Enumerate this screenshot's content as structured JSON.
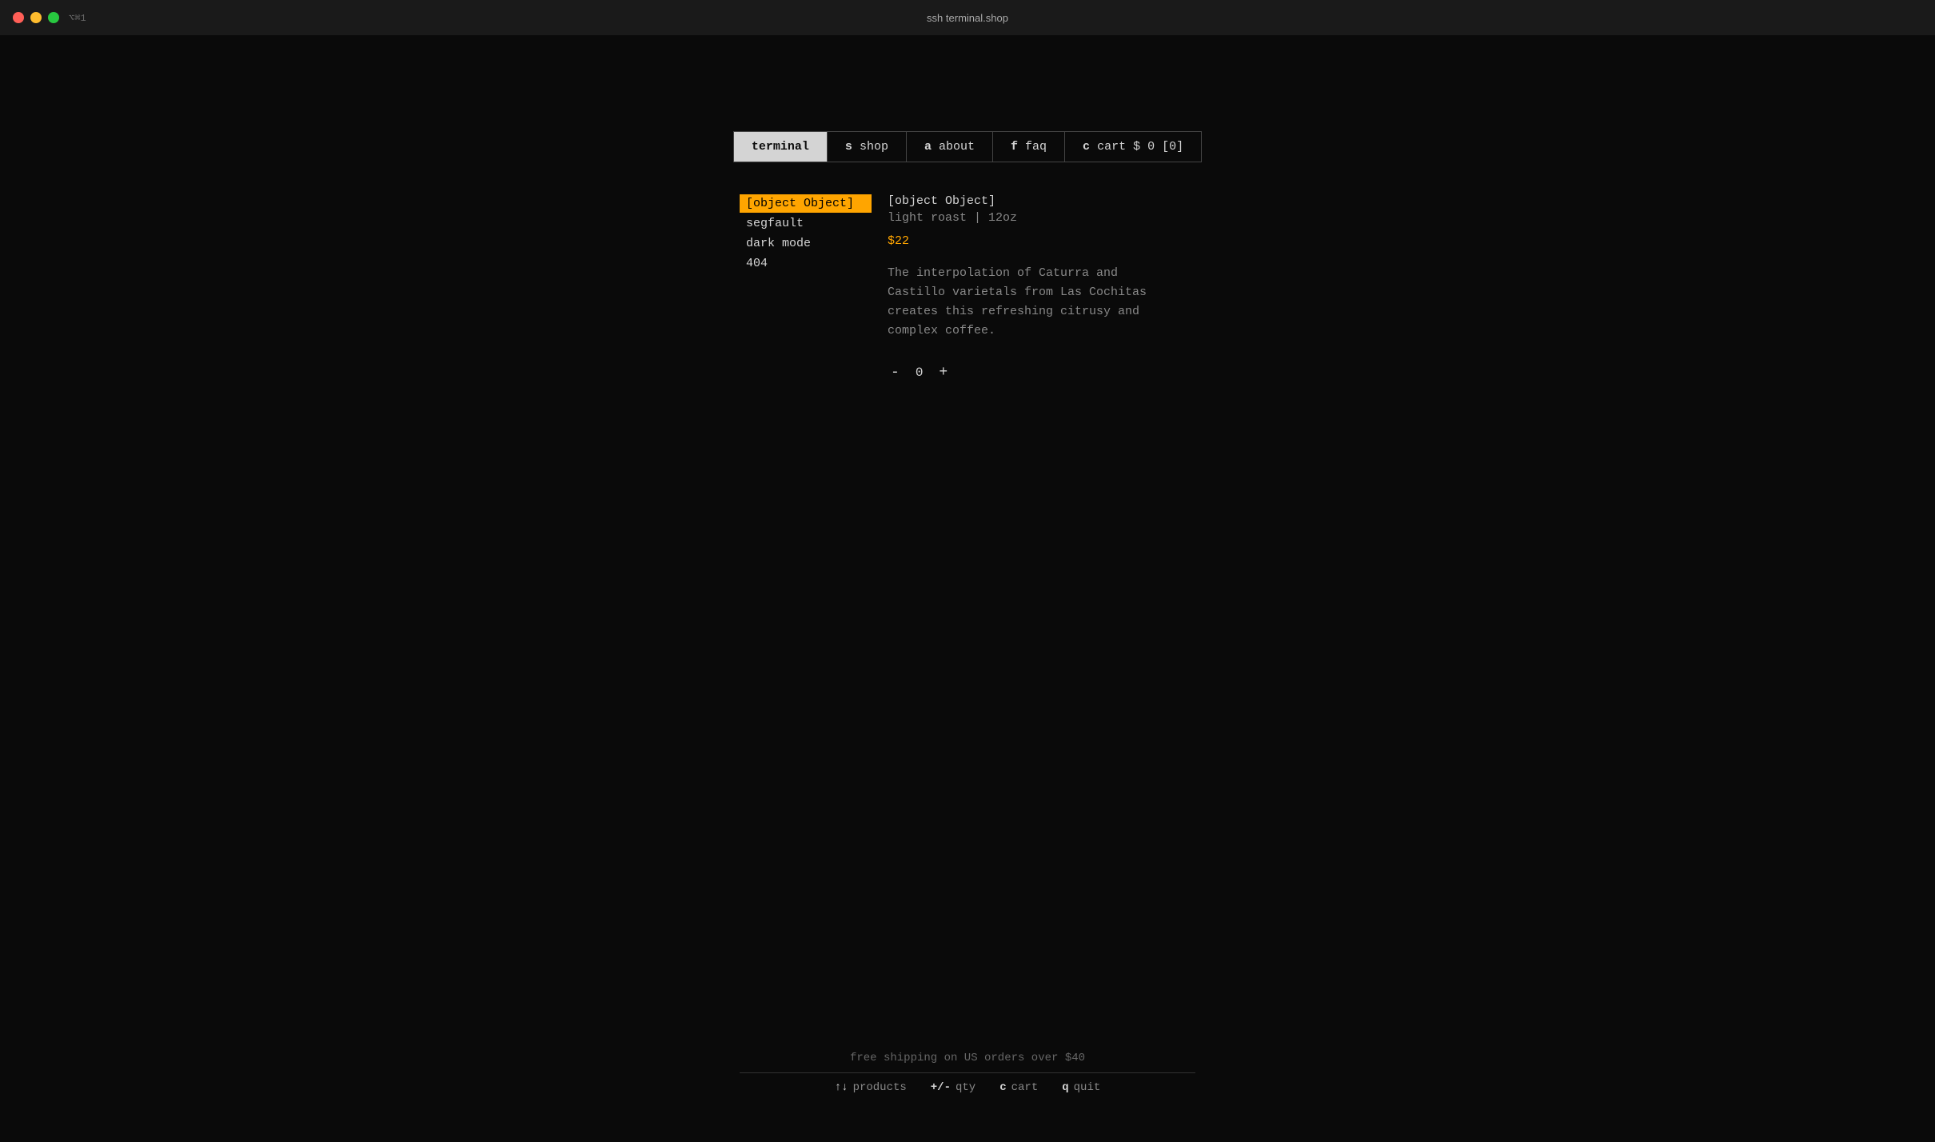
{
  "titlebar": {
    "title": "ssh terminal.shop",
    "shortcut": "⌥⌘1"
  },
  "nav": {
    "tabs": [
      {
        "key": "",
        "label": "terminal",
        "active": true
      },
      {
        "key": "s",
        "label": "shop",
        "active": false
      },
      {
        "key": "a",
        "label": "about",
        "active": false
      },
      {
        "key": "f",
        "label": "faq",
        "active": false
      },
      {
        "key": "c",
        "label": "cart $ 0 [0]",
        "active": false
      }
    ]
  },
  "sidebar": {
    "items": [
      {
        "label": "[object Object]",
        "active": true
      },
      {
        "label": "segfault",
        "active": false
      },
      {
        "label": "dark mode",
        "active": false
      },
      {
        "label": "404",
        "active": false
      }
    ]
  },
  "product": {
    "name": "[object Object]",
    "subtitle": "light roast | 12oz",
    "price": "$22",
    "description": "The interpolation of Caturra and\nCastillo varietals from Las Cochitas\ncreates this refreshing citrusy and\ncomplex coffee.",
    "quantity": "0"
  },
  "qty_control": {
    "decrement": "-",
    "increment": "+"
  },
  "footer": {
    "shipping_text": "free shipping on US orders over $40",
    "nav_items": [
      {
        "key": "↑↓",
        "label": "products"
      },
      {
        "key": "+/-",
        "label": "qty"
      },
      {
        "key": "c",
        "label": "cart"
      },
      {
        "key": "q",
        "label": "quit"
      }
    ]
  }
}
